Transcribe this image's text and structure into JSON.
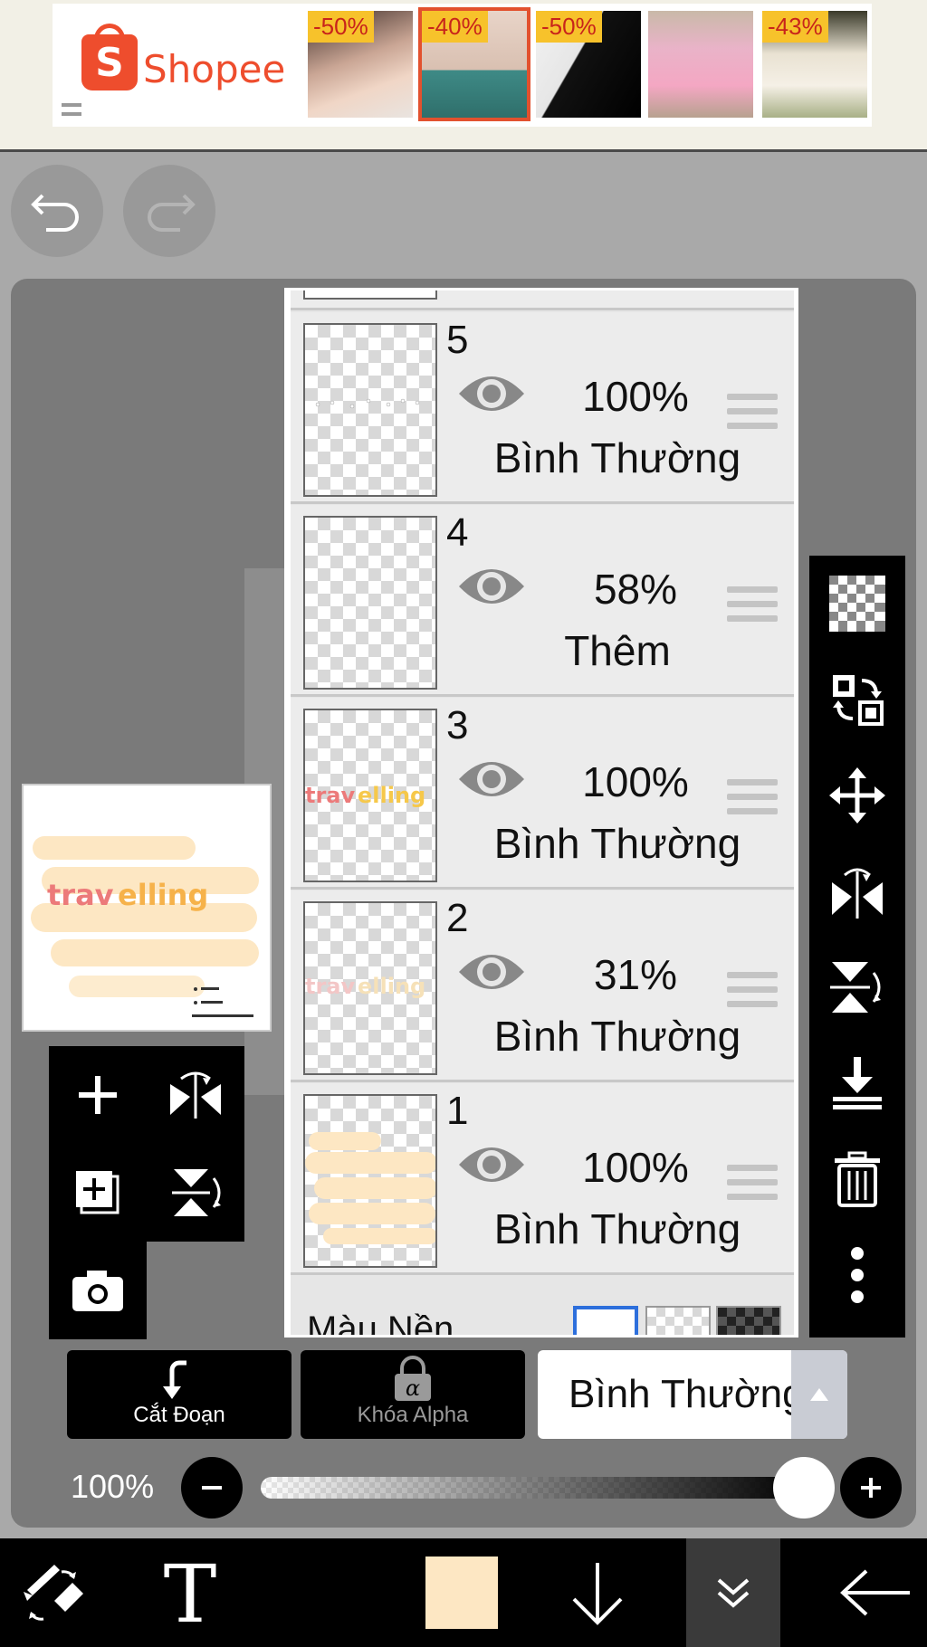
{
  "ad": {
    "brand": "Shopee",
    "thumbs": [
      {
        "discount": "-50%"
      },
      {
        "discount": "-40%"
      },
      {
        "discount": "-50%"
      },
      {
        "discount": ""
      },
      {
        "discount": "-43%"
      }
    ]
  },
  "history": {
    "undo": "undo-icon",
    "redo": "redo-icon"
  },
  "layers": [
    {
      "number": "5",
      "opacity": "100%",
      "mode": "Bình Thường"
    },
    {
      "number": "4",
      "opacity": "58%",
      "mode": "Thêm"
    },
    {
      "number": "3",
      "opacity": "100%",
      "mode": "Bình Thường"
    },
    {
      "number": "2",
      "opacity": "31%",
      "mode": "Bình Thường"
    },
    {
      "number": "1",
      "opacity": "100%",
      "mode": "Bình Thường"
    }
  ],
  "background": {
    "label": "Màu Nền"
  },
  "controls": {
    "clip_label": "Cắt Đoạn",
    "alpha_lock_label": "Khóa Alpha",
    "blend_mode": "Bình Thường"
  },
  "opacity": {
    "label": "100%",
    "value": 1.0
  },
  "colors": {
    "accent": "#ee4d2d",
    "current_color": "#fde7c3",
    "panel_bg": "#ececec",
    "toolbar_bg": "#000000"
  }
}
